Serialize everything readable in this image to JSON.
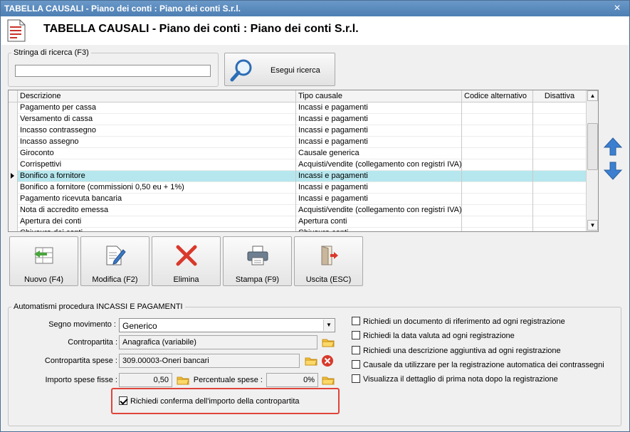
{
  "window": {
    "title": "TABELLA CAUSALI - Piano dei conti : Piano dei conti S.r.l.",
    "close_glyph": "✕"
  },
  "header": {
    "title": "TABELLA CAUSALI - Piano dei conti : Piano dei conti S.r.l."
  },
  "search": {
    "group_label": "Stringa di ricerca (F3)",
    "value": "",
    "button_label": "Esegui ricerca"
  },
  "grid": {
    "columns": [
      "Descrizione",
      "Tipo causale",
      "Codice alternativo",
      "Disattiva"
    ],
    "selected_index": 6,
    "rows": [
      {
        "descrizione": "Pagamento per cassa",
        "tipo": "Incassi e pagamenti",
        "codice": "",
        "disattiva": ""
      },
      {
        "descrizione": "Versamento di cassa",
        "tipo": "Incassi e pagamenti",
        "codice": "",
        "disattiva": ""
      },
      {
        "descrizione": "Incasso contrassegno",
        "tipo": "Incassi e pagamenti",
        "codice": "",
        "disattiva": ""
      },
      {
        "descrizione": "Incasso assegno",
        "tipo": "Incassi e pagamenti",
        "codice": "",
        "disattiva": ""
      },
      {
        "descrizione": "Giroconto",
        "tipo": "Causale generica",
        "codice": "",
        "disattiva": ""
      },
      {
        "descrizione": "Corrispettivi",
        "tipo": "Acquisti/vendite (collegamento con registri IVA)",
        "codice": "",
        "disattiva": ""
      },
      {
        "descrizione": "Bonifico a fornitore",
        "tipo": "Incassi e pagamenti",
        "codice": "",
        "disattiva": ""
      },
      {
        "descrizione": "Bonifico a fornitore (commissioni 0,50 eu + 1%)",
        "tipo": "Incassi e pagamenti",
        "codice": "",
        "disattiva": ""
      },
      {
        "descrizione": "Pagamento ricevuta bancaria",
        "tipo": "Incassi e pagamenti",
        "codice": "",
        "disattiva": ""
      },
      {
        "descrizione": "Nota di accredito emessa",
        "tipo": "Acquisti/vendite (collegamento con registri IVA)",
        "codice": "",
        "disattiva": ""
      },
      {
        "descrizione": "Apertura dei conti",
        "tipo": "Apertura conti",
        "codice": "",
        "disattiva": ""
      },
      {
        "descrizione": "Chiusura dei conti",
        "tipo": "Chiusura conti",
        "codice": "",
        "disattiva": ""
      }
    ]
  },
  "toolbar": {
    "nuovo": "Nuovo (F4)",
    "modifica": "Modifica (F2)",
    "elimina": "Elimina",
    "stampa": "Stampa (F9)",
    "uscita": "Uscita (ESC)"
  },
  "automatismi": {
    "group_label": "Automatismi procedura INCASSI E PAGAMENTI",
    "segno_label": "Segno movimento :",
    "segno_value": "Generico",
    "contropartita_label": "Contropartita :",
    "contropartita_value": "Anagrafica (variabile)",
    "contropartita_spese_label": "Contropartita spese :",
    "contropartita_spese_value": "309.00003-Oneri bancari",
    "importo_label": "Importo spese fisse :",
    "importo_value": "0,50",
    "percentuale_label": "Percentuale spese :",
    "percentuale_value": "0%",
    "conferma_label": "Richiedi conferma dell'importo della contropartita",
    "conferma_checked": true,
    "options": [
      {
        "label": "Richiedi un documento di riferimento ad ogni registrazione",
        "checked": false
      },
      {
        "label": "Richiedi la data valuta ad ogni registrazione",
        "checked": false
      },
      {
        "label": "Richiedi una descrizione aggiuntiva ad ogni registrazione",
        "checked": false
      },
      {
        "label": "Causale da utilizzare per la registrazione automatica dei contrassegni",
        "checked": false
      },
      {
        "label": "Visualizza il dettaglio di prima nota dopo la registrazione",
        "checked": false
      }
    ]
  },
  "colors": {
    "selected_row": "#b6e7ee",
    "arrow_blue": "#3c7fd0",
    "delete_red": "#d9392b",
    "highlight": "#e0443a"
  }
}
